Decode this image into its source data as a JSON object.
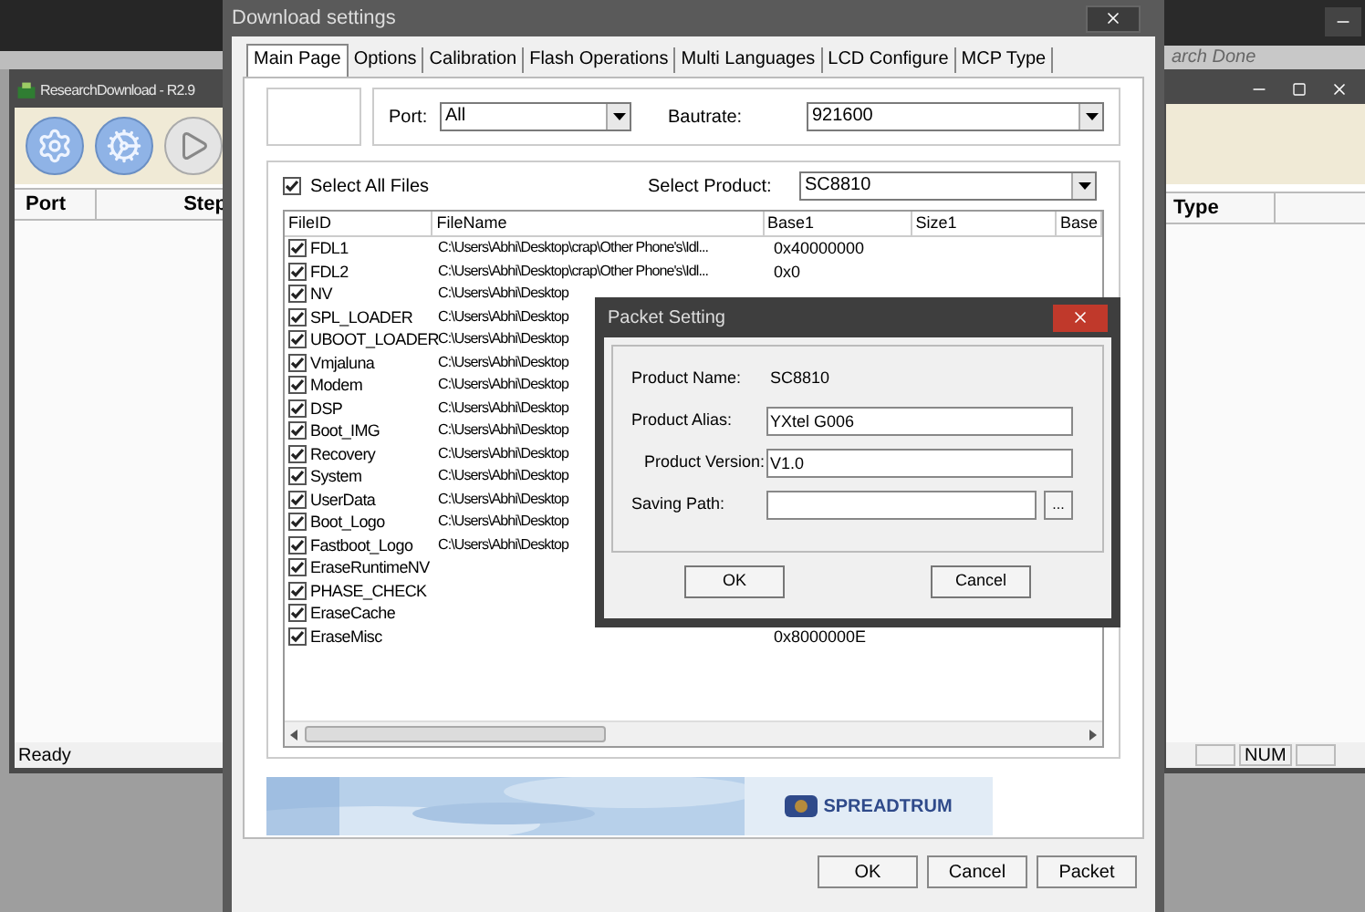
{
  "back_window": {
    "title": "ResearchDownload - R2.9",
    "columns": [
      "Port",
      "Step"
    ],
    "status": "Ready"
  },
  "right_window": {
    "behind_title": "arch Done",
    "columns": [
      "Type"
    ],
    "status": "NUM"
  },
  "download_settings": {
    "title": "Download settings",
    "tabs": [
      {
        "label": "Main Page",
        "selected": true
      },
      {
        "label": "Options",
        "selected": false
      },
      {
        "label": "Calibration",
        "selected": false
      },
      {
        "label": "Flash Operations",
        "selected": false
      },
      {
        "label": "Multi Languages",
        "selected": false
      },
      {
        "label": "LCD Configure",
        "selected": false
      },
      {
        "label": "MCP Type",
        "selected": false
      }
    ],
    "port": {
      "label": "Port:",
      "value": "All"
    },
    "baudrate": {
      "label": "Bautrate:",
      "value": "921600"
    },
    "select_all": {
      "label": "Select All Files",
      "checked": true
    },
    "product": {
      "label": "Select Product:",
      "value": "SC8810"
    },
    "table": {
      "columns": [
        "FileID",
        "FileName",
        "Base1",
        "Size1",
        "Base"
      ],
      "rows": [
        {
          "file_id": "FDL1",
          "checked": true,
          "file_name": "C:\\Users\\Abhi\\Desktop\\crap\\Other Phone's\\Idl...",
          "base1": "0x40000000"
        },
        {
          "file_id": "FDL2",
          "checked": true,
          "file_name": "C:\\Users\\Abhi\\Desktop\\crap\\Other Phone's\\Idl...",
          "base1": "0x0"
        },
        {
          "file_id": "NV",
          "checked": true,
          "file_name": "C:\\Users\\Abhi\\Desktop"
        },
        {
          "file_id": "SPL_LOADER",
          "checked": true,
          "file_name": "C:\\Users\\Abhi\\Desktop"
        },
        {
          "file_id": "UBOOT_LOADER",
          "checked": true,
          "file_name": "C:\\Users\\Abhi\\Desktop"
        },
        {
          "file_id": "Vmjaluna",
          "checked": true,
          "file_name": "C:\\Users\\Abhi\\Desktop"
        },
        {
          "file_id": "Modem",
          "checked": true,
          "file_name": "C:\\Users\\Abhi\\Desktop"
        },
        {
          "file_id": "DSP",
          "checked": true,
          "file_name": "C:\\Users\\Abhi\\Desktop"
        },
        {
          "file_id": "Boot_IMG",
          "checked": true,
          "file_name": "C:\\Users\\Abhi\\Desktop"
        },
        {
          "file_id": "Recovery",
          "checked": true,
          "file_name": "C:\\Users\\Abhi\\Desktop"
        },
        {
          "file_id": "System",
          "checked": true,
          "file_name": "C:\\Users\\Abhi\\Desktop"
        },
        {
          "file_id": "UserData",
          "checked": true,
          "file_name": "C:\\Users\\Abhi\\Desktop"
        },
        {
          "file_id": "Boot_Logo",
          "checked": true,
          "file_name": "C:\\Users\\Abhi\\Desktop"
        },
        {
          "file_id": "Fastboot_Logo",
          "checked": true,
          "file_name": "C:\\Users\\Abhi\\Desktop"
        },
        {
          "file_id": "EraseRuntimeNV",
          "checked": true
        },
        {
          "file_id": "PHASE_CHECK",
          "checked": true
        },
        {
          "file_id": "EraseCache",
          "checked": true
        },
        {
          "file_id": "EraseMisc",
          "checked": true,
          "base1": "0x8000000E"
        }
      ]
    },
    "banner": {
      "logo_text": "SPREADTRUM"
    },
    "buttons": [
      "OK",
      "Cancel",
      "Packet"
    ]
  },
  "packet_setting": {
    "title": "Packet Setting",
    "product_name": {
      "label": "Product Name:",
      "value": "SC8810"
    },
    "fields": [
      {
        "label": "Product Alias:",
        "value": "YXtel G006"
      },
      {
        "label": "Product Version:",
        "value": "V1.0"
      },
      {
        "label": "Saving Path:",
        "browse": "..."
      }
    ],
    "buttons": [
      "OK",
      "Cancel"
    ]
  }
}
